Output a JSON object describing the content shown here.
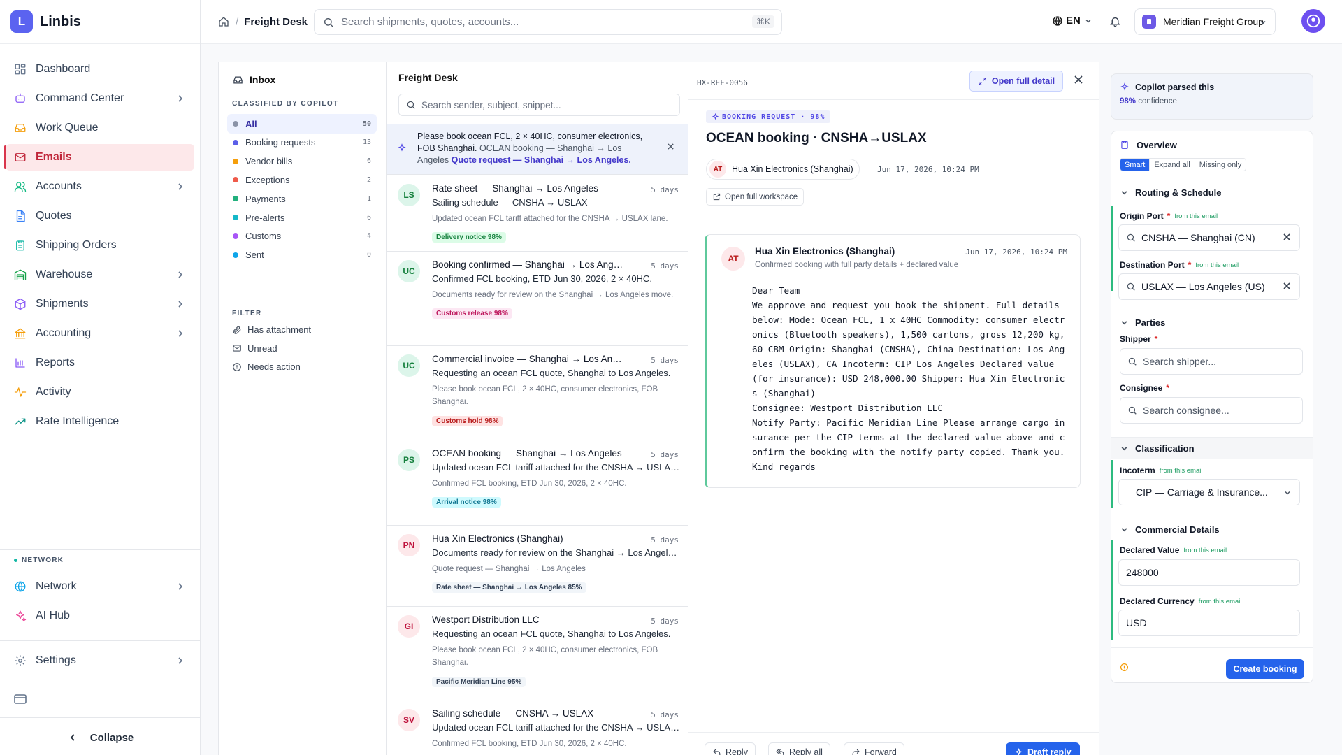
{
  "brand": {
    "logo_letter": "L",
    "name": "Linbis"
  },
  "nav": [
    {
      "label": "Dashboard",
      "icon": "dashboard-icon",
      "chevron": false
    },
    {
      "label": "Command Center",
      "icon": "command-center-icon",
      "chevron": true
    },
    {
      "label": "Work Queue",
      "icon": "inbox-tray-icon",
      "chevron": false
    },
    {
      "label": "Emails",
      "icon": "mail-icon",
      "chevron": false,
      "active": true
    },
    {
      "label": "Accounts",
      "icon": "users-icon",
      "chevron": true
    },
    {
      "label": "Quotes",
      "icon": "document-icon",
      "chevron": false
    },
    {
      "label": "Shipping Orders",
      "icon": "clipboard-icon",
      "chevron": false
    },
    {
      "label": "Warehouse",
      "icon": "warehouse-icon",
      "chevron": true
    },
    {
      "label": "Shipments",
      "icon": "box-icon",
      "chevron": true
    },
    {
      "label": "Accounting",
      "icon": "bank-icon",
      "chevron": true
    },
    {
      "label": "Reports",
      "icon": "bar-chart-icon",
      "chevron": false
    },
    {
      "label": "Activity",
      "icon": "activity-icon",
      "chevron": false
    },
    {
      "label": "Rate Intelligence",
      "icon": "trend-icon",
      "chevron": false
    }
  ],
  "network_section": {
    "label": "NETWORK",
    "items": [
      {
        "label": "Network",
        "icon": "globe-icon",
        "chevron": true
      },
      {
        "label": "AI Hub",
        "icon": "sparkles-icon",
        "chevron": false
      }
    ]
  },
  "settings_label": "Settings",
  "collapse_label": "Collapse",
  "topbar": {
    "breadcrumb_sep": "/",
    "page": "Freight Desk",
    "search_placeholder": "Search shipments, quotes, accounts...",
    "shortcut": "⌘K",
    "lang": "EN",
    "org_name": "Meridian Freight Group"
  },
  "inbox": {
    "title": "Inbox",
    "classified_label": "CLASSIFIED BY COPILOT",
    "folders": [
      {
        "label": "All",
        "count": "50",
        "color": "#8b93a7",
        "active": true
      },
      {
        "label": "Booking requests",
        "count": "13",
        "color": "#5b5fe8"
      },
      {
        "label": "Vendor bills",
        "count": "6",
        "color": "#f59e0b"
      },
      {
        "label": "Exceptions",
        "count": "2",
        "color": "#ef5a4a"
      },
      {
        "label": "Payments",
        "count": "1",
        "color": "#22b07d"
      },
      {
        "label": "Pre-alerts",
        "count": "6",
        "color": "#14b8c8"
      },
      {
        "label": "Customs",
        "count": "4",
        "color": "#a855f7"
      },
      {
        "label": "Sent",
        "count": "0",
        "color": "#0ea5e9"
      }
    ],
    "filter_label": "FILTER",
    "filters": [
      {
        "label": "Has attachment",
        "icon": "paperclip-icon"
      },
      {
        "label": "Unread",
        "icon": "mail-icon"
      },
      {
        "label": "Needs action",
        "icon": "alert-circle-icon"
      }
    ]
  },
  "list": {
    "title": "Freight Desk",
    "search_placeholder": "Search sender, subject, snippet...",
    "banner": {
      "text": "Please book ocean FCL, 2 × 40HC, consumer electronics, FOB Shanghai.",
      "muted": " OCEAN booking — Shanghai → Los Angeles",
      "link": "Quote request — Shanghai → Los Angeles."
    },
    "messages": [
      {
        "initials": "LS",
        "from": "Rate sheet — Shanghai → Los Angeles",
        "date": "5 days",
        "subject": "Sailing schedule — CNSHA → USLAX",
        "snippet": "Updated ocean FCL tariff attached for the CNSHA → USLAX lane.",
        "tag": "Delivery notice  98%",
        "tag_bg": "#dcfce7",
        "tag_fg": "#15803d",
        "av_bg": "#dcf5ea",
        "av_fg": "#15803d"
      },
      {
        "initials": "UC",
        "from": "Booking confirmed — Shanghai → Los Angeles",
        "date": "5 days",
        "subject": "Confirmed FCL booking, ETD Jun 30, 2026, 2 × 40HC.",
        "snippet": "Documents ready for review on the Shanghai → Los Angeles move.",
        "tag": "Customs release  98%",
        "tag_bg": "#fce7f3",
        "tag_fg": "#be185d",
        "av_bg": "#dcf5ea",
        "av_fg": "#15803d"
      },
      {
        "initials": "UC",
        "from": "Commercial invoice — Shanghai → Los Angeles",
        "date": "5 days",
        "subject": "Requesting an ocean FCL quote, Shanghai to Los Angeles.",
        "snippet": "Please book ocean FCL, 2 × 40HC, consumer electronics, FOB Shanghai.",
        "tag": "Customs hold  98%",
        "tag_bg": "#fee2e2",
        "tag_fg": "#b91c1c",
        "av_bg": "#dcf5ea",
        "av_fg": "#15803d"
      },
      {
        "initials": "PS",
        "from": "OCEAN booking — Shanghai → Los Angeles",
        "date": "5 days",
        "subject": "Updated ocean FCL tariff attached for the CNSHA → USLAX lane.",
        "snippet": "Confirmed FCL booking, ETD Jun 30, 2026, 2 × 40HC.",
        "tag": "Arrival notice  98%",
        "tag_bg": "#cffafe",
        "tag_fg": "#0e7490",
        "av_bg": "#dcf5ea",
        "av_fg": "#15803d"
      },
      {
        "initials": "PN",
        "from": "Hua Xin Electronics (Shanghai)",
        "date": "5 days",
        "subject": "Documents ready for review on the Shanghai → Los Angeles move.",
        "snippet": "Quote request — Shanghai → Los Angeles",
        "tag": "Rate sheet — Shanghai → Los Angeles  85%",
        "tag_bg": "#f1f5f9",
        "tag_fg": "#334155",
        "av_bg": "#fde8ea",
        "av_fg": "#be123c"
      },
      {
        "initials": "GI",
        "from": "Westport Distribution LLC",
        "date": "5 days",
        "subject": "Requesting an ocean FCL quote, Shanghai to Los Angeles.",
        "snippet": "Please book ocean FCL, 2 × 40HC, consumer electronics, FOB Shanghai.",
        "tag": "Pacific Meridian Line  95%",
        "tag_bg": "#f1f5f9",
        "tag_fg": "#334155",
        "av_bg": "#fde8ea",
        "av_fg": "#be123c"
      },
      {
        "initials": "SV",
        "from": "Sailing schedule — CNSHA → USLAX",
        "date": "5 days",
        "subject": "Updated ocean FCL tariff attached for the CNSHA → USLAX lane.",
        "snippet": "Confirmed FCL booking, ETD Jun 30, 2026, 2 × 40HC.",
        "tag": "",
        "tag_bg": "#f1f5f9",
        "tag_fg": "#334155",
        "av_bg": "#fde8ea",
        "av_fg": "#be123c"
      }
    ]
  },
  "reader": {
    "ref": "HX-REF-0056",
    "open_full_label": "Open full detail",
    "badge": "BOOKING REQUEST · 98%",
    "subject": "OCEAN booking · CNSHA→USLAX",
    "sender_initials": "AT",
    "sender": "Hua Xin Electronics (Shanghai)",
    "date": "Jun 17, 2026, 10:24 PM",
    "open_workspace_label": "Open full workspace",
    "card": {
      "from": "Hua Xin Electronics (Shanghai)",
      "date": "Jun 17, 2026, 10:24 PM",
      "summary": "Confirmed booking with full party details + declared value",
      "body": "Dear Team\nWe approve and request you book the shipment. Full details below: Mode: Ocean FCL, 1 x 40HC Commodity: consumer electronics (Bluetooth speakers), 1,500 cartons, gross 12,200 kg, 60 CBM Origin: Shanghai (CNSHA), China Destination: Los Angeles (USLAX), CA Incoterm: CIP Los Angeles Declared value (for insurance): USD 248,000.00 Shipper: Hua Xin Electronics (Shanghai)\nConsignee: Westport Distribution LLC\nNotify Party: Pacific Meridian Line Please arrange cargo insurance per the CIP terms at the declared value above and confirm the booking with the notify party copied. Thank you. Kind regards"
    },
    "actions": {
      "reply": "Reply",
      "reply_all": "Reply all",
      "forward": "Forward",
      "draft": "Draft reply"
    }
  },
  "form": {
    "parsed_title": "Copilot parsed this",
    "parsed_conf": "98%",
    "parsed_conf_suffix": " confidence",
    "overview": "Overview",
    "modes": [
      "Smart",
      "Expand all",
      "Missing only"
    ],
    "from_email": "from this email",
    "routing": "Routing & Schedule",
    "origin_label": "Origin Port",
    "origin_value": "CNSHA — Shanghai (CN)",
    "dest_label": "Destination Port",
    "dest_value": "USLAX — Los Angeles (US)",
    "parties": "Parties",
    "shipper_label": "Shipper",
    "shipper_placeholder": "Search shipper...",
    "consignee_label": "Consignee",
    "consignee_placeholder": "Search consignee...",
    "classification": "Classification",
    "incoterm_label": "Incoterm",
    "incoterm_value": "CIP — Carriage & Insurance...",
    "commercial": "Commercial Details",
    "declared_value_label": "Declared Value",
    "declared_value": "248000",
    "declared_currency_label": "Declared Currency",
    "declared_currency": "USD",
    "create_booking": "Create booking"
  }
}
